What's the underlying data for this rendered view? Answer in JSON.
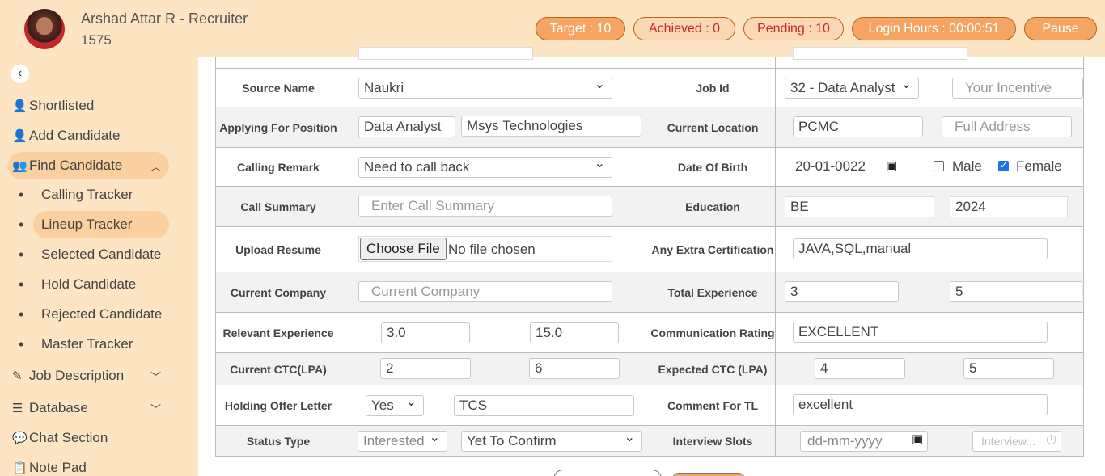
{
  "header": {
    "user_name": "Arshad Attar R - Recruiter",
    "user_id": "1575",
    "target": "Target : 10",
    "achieved": "Achieved : 0",
    "pending": "Pending : 10",
    "login_hours": "Login Hours : 00:00:51",
    "pause": "Pause"
  },
  "sidebar": {
    "collapse_icon": "chevron-left-icon",
    "items": [
      {
        "label": "Shortlisted",
        "icon": "user-check-icon"
      },
      {
        "label": "Add Candidate",
        "icon": "user-plus-icon"
      },
      {
        "label": "Find Candidate",
        "icon": "users-icon",
        "expanded": true
      },
      {
        "label": "Job Description",
        "icon": "edit-icon"
      },
      {
        "label": "Database",
        "icon": "database-icon"
      },
      {
        "label": "Chat Section",
        "icon": "chat-icon"
      },
      {
        "label": "Note Pad",
        "icon": "clipboard-icon"
      }
    ],
    "sub_items": [
      {
        "label": "Calling Tracker"
      },
      {
        "label": "Lineup Tracker",
        "active": true
      },
      {
        "label": "Selected Candidate"
      },
      {
        "label": "Hold Candidate"
      },
      {
        "label": "Rejected Candidate"
      },
      {
        "label": "Master Tracker"
      }
    ]
  },
  "form": {
    "source_name": {
      "label": "Source Name",
      "value": "Naukri"
    },
    "job_id": {
      "label": "Job Id",
      "value": "32 - Data Analyst",
      "incentive_placeholder": "Your Incentive"
    },
    "applying_for": {
      "label": "Applying For Position",
      "position": "Data Analyst",
      "company": "Msys Technologies"
    },
    "current_location": {
      "label": "Current Location",
      "value": "PCMC",
      "address_placeholder": "Full Address"
    },
    "calling_remark": {
      "label": "Calling Remark",
      "value": "Need to call back"
    },
    "date_of_birth": {
      "label": "Date Of Birth",
      "value": "20-01-0022",
      "male": "Male",
      "female": "Female",
      "female_checked": true,
      "male_checked": false
    },
    "call_summary": {
      "label": "Call Summary",
      "placeholder": "Enter Call Summary"
    },
    "education": {
      "label": "Education",
      "degree": "BE",
      "year": "2024"
    },
    "upload_resume": {
      "label": "Upload Resume",
      "button": "Choose File",
      "status": "No file chosen"
    },
    "extra_certification": {
      "label": "Any Extra Certification",
      "value": "JAVA,SQL,manual"
    },
    "current_company": {
      "label": "Current Company",
      "placeholder": "Current Company"
    },
    "total_experience": {
      "label": "Total Experience",
      "years": "3",
      "months": "5"
    },
    "relevant_experience": {
      "label": "Relevant Experience",
      "years": "3.0",
      "months": "15.0"
    },
    "communication_rating": {
      "label": "Communication Rating",
      "value": "EXCELLENT"
    },
    "current_ctc": {
      "label": "Current CTC(LPA)",
      "lakh": "2",
      "thousand": "6"
    },
    "expected_ctc": {
      "label": "Expected CTC (LPA)",
      "lakh": "4",
      "thousand": "5"
    },
    "holding_offer": {
      "label": "Holding Offer Letter",
      "value": "Yes",
      "company": "TCS"
    },
    "comment_for_tl": {
      "label": "Comment For TL",
      "value": "excellent"
    },
    "status_type": {
      "label": "Status Type",
      "value": "Interested",
      "confirmation": "Yet To Confirm"
    },
    "interview_slots": {
      "label": "Interview Slots",
      "date_placeholder": "dd-mm-yyyy",
      "time_placeholder": "Interview..."
    }
  }
}
